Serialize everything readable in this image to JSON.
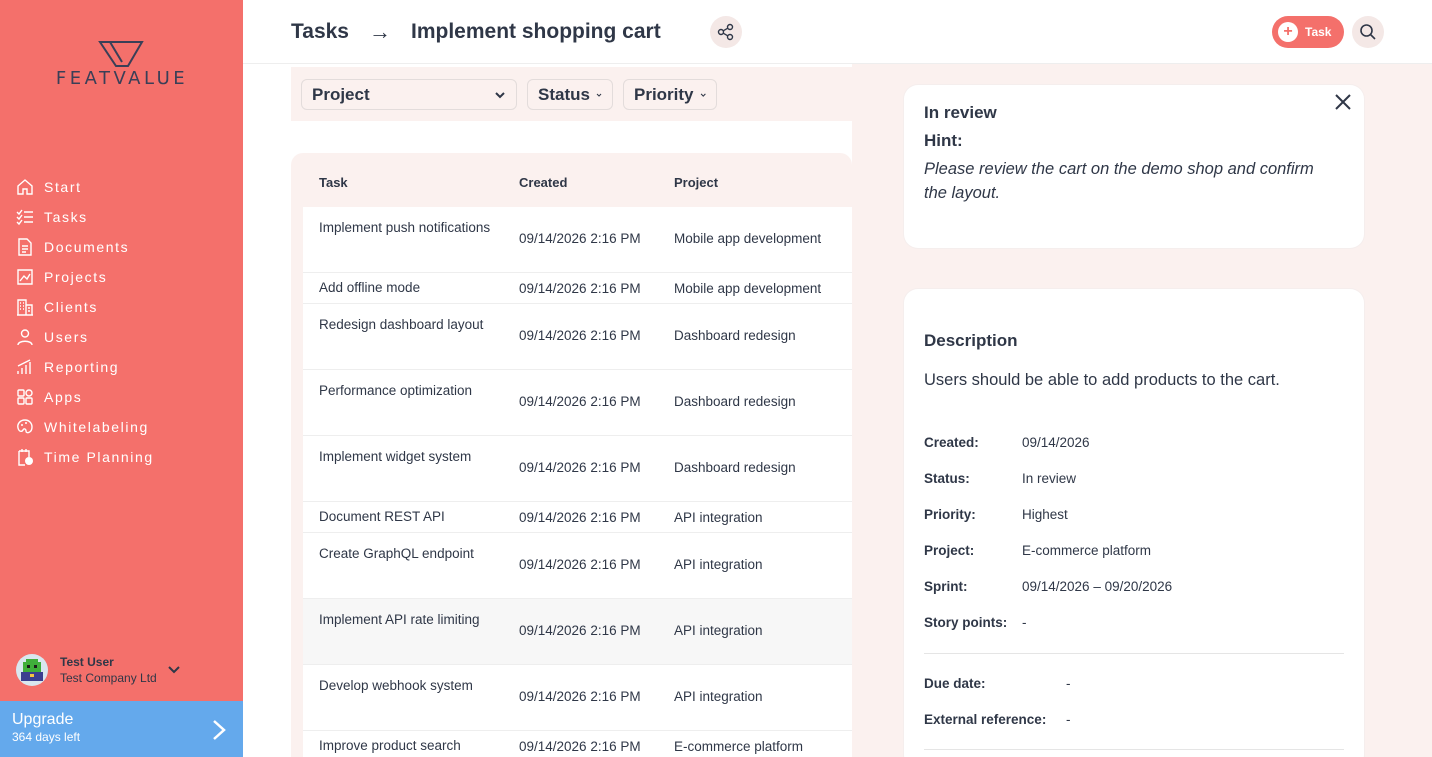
{
  "brand": {
    "name": "FEATVALUE",
    "color": "#f4706b"
  },
  "sidebar": {
    "items": [
      {
        "label": "Start",
        "icon": "home-icon"
      },
      {
        "label": "Tasks",
        "icon": "tasks-icon"
      },
      {
        "label": "Documents",
        "icon": "documents-icon"
      },
      {
        "label": "Projects",
        "icon": "projects-icon"
      },
      {
        "label": "Clients",
        "icon": "clients-icon"
      },
      {
        "label": "Users",
        "icon": "user-icon"
      },
      {
        "label": "Reporting",
        "icon": "reporting-icon"
      },
      {
        "label": "Apps",
        "icon": "apps-icon"
      },
      {
        "label": "Whitelabeling",
        "icon": "whitelabeling-icon"
      },
      {
        "label": "Time Planning",
        "icon": "time-planning-icon"
      }
    ],
    "user": {
      "name": "Test User",
      "company": "Test Company Ltd"
    },
    "upgrade": {
      "title": "Upgrade",
      "subtitle": "364 days left",
      "color": "#64a9ec"
    }
  },
  "header": {
    "crumb_root": "Tasks",
    "crumb_sep": "→",
    "title": "Implement shopping cart",
    "task_button": "Task"
  },
  "filters": {
    "project": "Project",
    "status": "Status",
    "priority": "Priority"
  },
  "table": {
    "columns": [
      "Task",
      "Created",
      "Project"
    ],
    "rows": [
      {
        "task": "Implement push notifications",
        "created": "09/14/2026 2:16 PM",
        "project": "Mobile app development"
      },
      {
        "task": "Add offline mode",
        "created": "09/14/2026 2:16 PM",
        "project": "Mobile app development"
      },
      {
        "task": "Redesign dashboard layout",
        "created": "09/14/2026 2:16 PM",
        "project": "Dashboard redesign"
      },
      {
        "task": "Performance optimization",
        "created": "09/14/2026 2:16 PM",
        "project": "Dashboard redesign"
      },
      {
        "task": "Implement widget system",
        "created": "09/14/2026 2:16 PM",
        "project": "Dashboard redesign"
      },
      {
        "task": "Document REST API",
        "created": "09/14/2026 2:16 PM",
        "project": "API integration"
      },
      {
        "task": "Create GraphQL endpoint",
        "created": "09/14/2026 2:16 PM",
        "project": "API integration"
      },
      {
        "task": "Implement API rate limiting",
        "created": "09/14/2026 2:16 PM",
        "project": "API integration"
      },
      {
        "task": "Develop webhook system",
        "created": "09/14/2026 2:16 PM",
        "project": "API integration"
      },
      {
        "task": "Improve product search",
        "created": "09/14/2026 2:16 PM",
        "project": "E-commerce platform"
      }
    ]
  },
  "hint": {
    "status": "In review",
    "label": "Hint:",
    "text": "Please review the cart on the demo shop and confirm the layout."
  },
  "details": {
    "heading": "Description",
    "description": "Users should be able to add products to the cart.",
    "created_label": "Created:",
    "created": "09/14/2026",
    "status_label": "Status:",
    "status": "In review",
    "priority_label": "Priority:",
    "priority": "Highest",
    "project_label": "Project:",
    "project": "E-commerce platform",
    "sprint_label": "Sprint:",
    "sprint": "09/14/2026 – 09/20/2026",
    "story_points_label": "Story points:",
    "story_points": "-",
    "due_date_label": "Due date:",
    "due_date": "-",
    "external_ref_label": "External reference:",
    "external_ref": "-"
  }
}
